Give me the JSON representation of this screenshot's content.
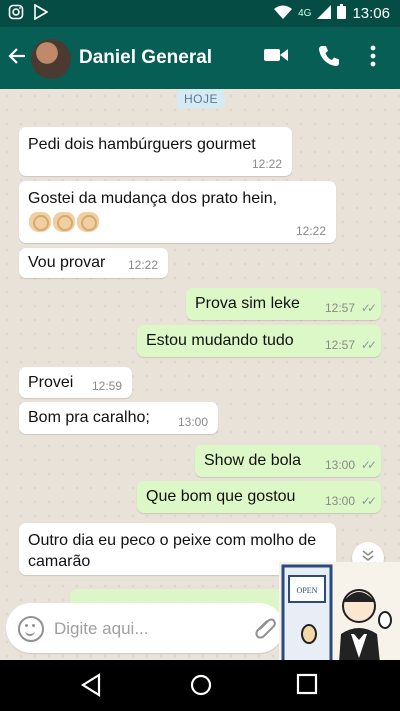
{
  "status_bar": {
    "left_icons": [
      "instagram-icon",
      "play-store-icon"
    ],
    "network": "4G",
    "time": "13:06",
    "right_icons": [
      "wifi-icon",
      "signal-icon",
      "battery-icon"
    ]
  },
  "app_bar": {
    "contact_name": "Daniel General",
    "icons": [
      "back-arrow-icon",
      "video-call-icon",
      "phone-icon",
      "more-vert-icon"
    ]
  },
  "chat": {
    "date_chip": "HOJE",
    "messages": [
      {
        "dir": "in",
        "text": "Pedi dois hambúrguers gourmet",
        "time": "12:22"
      },
      {
        "dir": "in",
        "text": "Gostei da mudança dos prato hein,",
        "emoji": "clapping-hands-icon",
        "emoji_count": 3,
        "time": "12:22"
      },
      {
        "dir": "in",
        "text": "Vou provar",
        "time": "12:22"
      },
      {
        "dir": "out",
        "text": "Prova sim leke",
        "time": "12:57"
      },
      {
        "dir": "out",
        "text": "Estou mudando tudo",
        "time": "12:57"
      },
      {
        "dir": "in",
        "text": "Provei",
        "time": "12:59"
      },
      {
        "dir": "in",
        "text": "Bom pra caralho;",
        "time": "13:00"
      },
      {
        "dir": "out",
        "text": "Show de bola",
        "time": "13:00"
      },
      {
        "dir": "out",
        "text": "Que bom que gostou",
        "time": "13:00"
      },
      {
        "dir": "in",
        "text": "Outro dia eu peco o peixe com molho de camarão",
        "time": ""
      }
    ],
    "read_receipt": "✓✓"
  },
  "composer": {
    "placeholder": "Digite aqui...",
    "icons": [
      "emoji-icon",
      "attach-icon",
      "send-icon"
    ]
  },
  "overlay": {
    "sign_text": "OPEN"
  },
  "colors": {
    "header": "#075e54",
    "status": "#054d44",
    "incoming": "#ffffff",
    "outgoing": "#dcf8c6",
    "accent": "#00897b"
  }
}
